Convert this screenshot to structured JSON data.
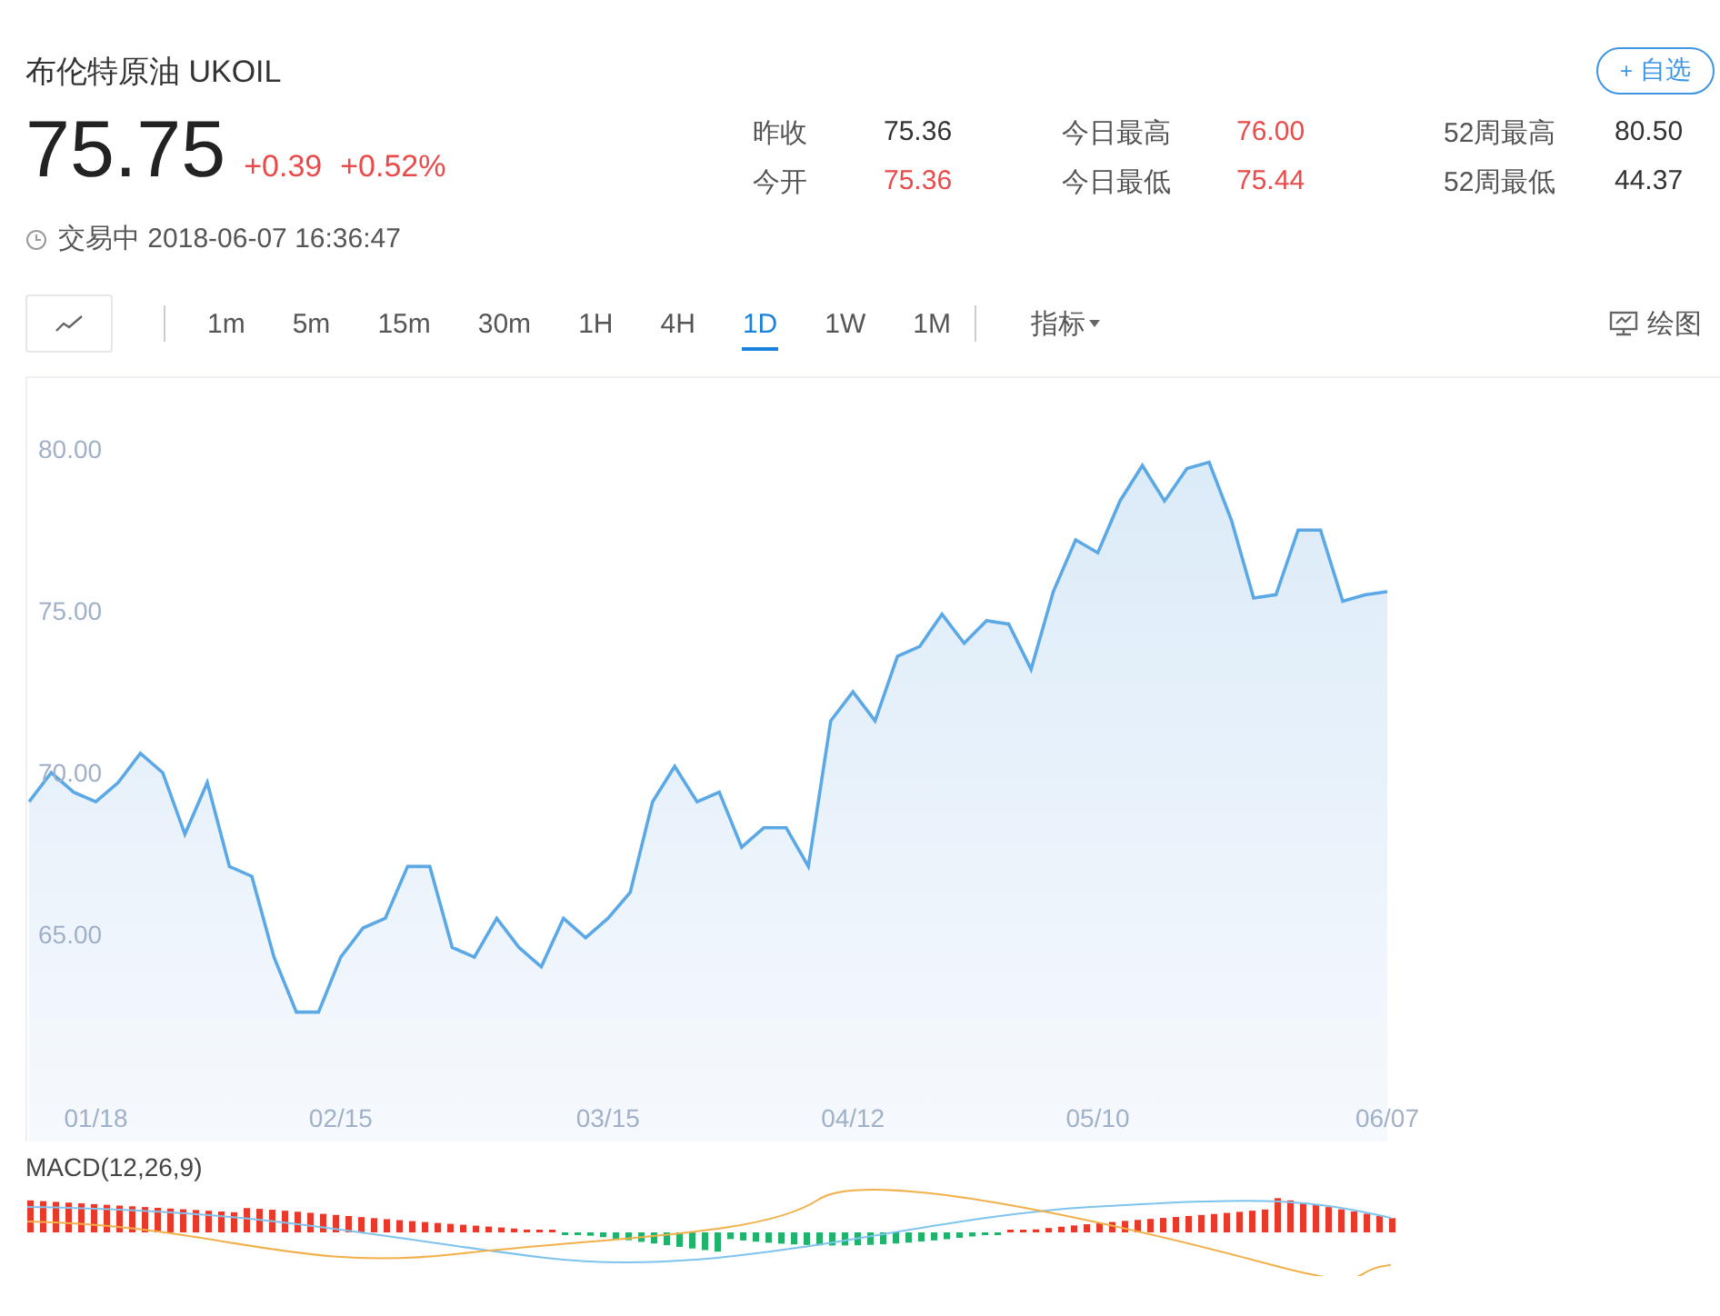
{
  "header": {
    "title": "布伦特原油 UKOIL",
    "watch_button": {
      "icon": "+",
      "label": "自选"
    }
  },
  "quote": {
    "price": "75.75",
    "change": "+0.39",
    "change_percent": "+0.52%"
  },
  "stats": [
    {
      "label": "昨收",
      "value": "75.36",
      "color": "#333333"
    },
    {
      "label": "今日最高",
      "value": "76.00",
      "color": "#e94b4b"
    },
    {
      "label": "52周最高",
      "value": "80.50",
      "color": "#333333"
    },
    {
      "label": "今开",
      "value": "75.36",
      "color": "#e94b4b"
    },
    {
      "label": "今日最低",
      "value": "75.44",
      "color": "#e94b4b"
    },
    {
      "label": "52周最低",
      "value": "44.37",
      "color": "#333333"
    }
  ],
  "status": {
    "text": "交易中 2018-06-07 16:36:47"
  },
  "toolbar": {
    "periods": [
      {
        "label": "1m",
        "selected": false
      },
      {
        "label": "5m",
        "selected": false
      },
      {
        "label": "15m",
        "selected": false
      },
      {
        "label": "30m",
        "selected": false
      },
      {
        "label": "1H",
        "selected": false
      },
      {
        "label": "4H",
        "selected": false
      },
      {
        "label": "1D",
        "selected": true
      },
      {
        "label": "1W",
        "selected": false
      },
      {
        "label": "1M",
        "selected": false
      }
    ],
    "indicator_menu": "指标",
    "draw_button": "绘图"
  },
  "chart": {
    "chart_data": {
      "type": "area",
      "categories": [
        null,
        null,
        null,
        "01/18",
        null,
        null,
        null,
        null,
        null,
        null,
        null,
        null,
        null,
        null,
        "02/15",
        null,
        null,
        null,
        null,
        null,
        null,
        null,
        null,
        null,
        null,
        null,
        "03/15",
        null,
        null,
        null,
        null,
        null,
        null,
        null,
        null,
        null,
        null,
        "04/12",
        null,
        null,
        null,
        null,
        null,
        null,
        null,
        null,
        null,
        null,
        "05/10",
        null,
        null,
        null,
        null,
        null,
        null,
        null,
        null,
        null,
        null,
        null,
        null,
        "06/07"
      ],
      "series": [
        {
          "color": "#5aa9e6",
          "values": [
            69.1,
            70.0,
            69.4,
            69.1,
            69.7,
            70.6,
            70.0,
            68.1,
            69.7,
            67.1,
            66.8,
            64.3,
            62.6,
            62.6,
            64.3,
            65.2,
            65.5,
            67.1,
            67.1,
            64.6,
            64.3,
            65.5,
            64.6,
            64.0,
            65.5,
            64.9,
            65.5,
            66.3,
            69.1,
            70.2,
            69.1,
            69.4,
            67.7,
            68.3,
            68.3,
            67.1,
            71.6,
            72.5,
            71.6,
            73.6,
            73.9,
            74.9,
            74.0,
            74.7,
            74.6,
            73.2,
            75.6,
            77.2,
            76.8,
            78.4,
            79.5,
            78.4,
            79.4,
            79.6,
            77.8,
            75.4,
            75.5,
            77.5,
            77.5,
            75.3,
            75.5,
            75.6
          ]
        }
      ],
      "ylim": [
        58.6,
        82.2
      ],
      "yticks": [
        {
          "value": 65,
          "label": "65.00"
        },
        {
          "value": 70,
          "label": "70.00"
        },
        {
          "value": 75,
          "label": "75.00"
        },
        {
          "value": 80,
          "label": "80.00"
        }
      ]
    }
  },
  "macd": {
    "title": "MACD(12,26,9)"
  }
}
